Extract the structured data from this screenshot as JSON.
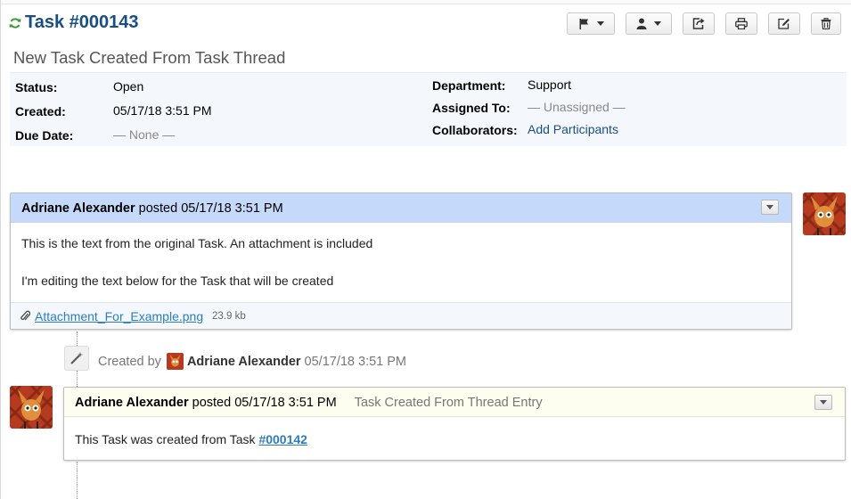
{
  "header": {
    "task_title": "Task #000143",
    "subject": "New Task Created From Task Thread"
  },
  "toolbar": {
    "buttons": [
      {
        "icon": "flag-icon",
        "has_dropdown": true
      },
      {
        "icon": "user-icon",
        "has_dropdown": true
      },
      {
        "icon": "share-icon",
        "has_dropdown": false
      },
      {
        "icon": "print-icon",
        "has_dropdown": false
      },
      {
        "icon": "edit-icon",
        "has_dropdown": false
      },
      {
        "icon": "trash-icon",
        "has_dropdown": false
      }
    ]
  },
  "info": {
    "status_label": "Status:",
    "status_value": "Open",
    "created_label": "Created:",
    "created_value": "05/17/18 3:51 PM",
    "due_label": "Due Date:",
    "due_value": "— None —",
    "department_label": "Department:",
    "department_value": "Support",
    "assigned_label": "Assigned To:",
    "assigned_value": "— Unassigned —",
    "collab_label": "Collaborators:",
    "collab_value": "Add Participants"
  },
  "entry1": {
    "author": "Adriane Alexander",
    "posted": "posted 05/17/18 3:51 PM",
    "line1": "This is the text from the original Task. An attachment is included",
    "line2": "I'm editing the text below for the Task that will be created",
    "attachment_name": "Attachment_For_Example.png",
    "attachment_size": "23.9 kb"
  },
  "event": {
    "created_by": "Created by",
    "author": "Adriane Alexander",
    "timestamp": "05/17/18 3:51 PM"
  },
  "entry2": {
    "author": "Adriane Alexander",
    "posted": "posted 05/17/18 3:51 PM",
    "tag": "Task Created From Thread Entry",
    "text": "This Task was created from Task",
    "task_link": "#000142"
  },
  "colors": {
    "title_blue": "#184e81",
    "link_blue": "#2d7cc2",
    "entry_header_blue": "#c5dafa",
    "entry_header_yellow": "#fdfdf0",
    "info_bg": "#f4f8fc",
    "refresh_green": "#3a9b3a"
  }
}
